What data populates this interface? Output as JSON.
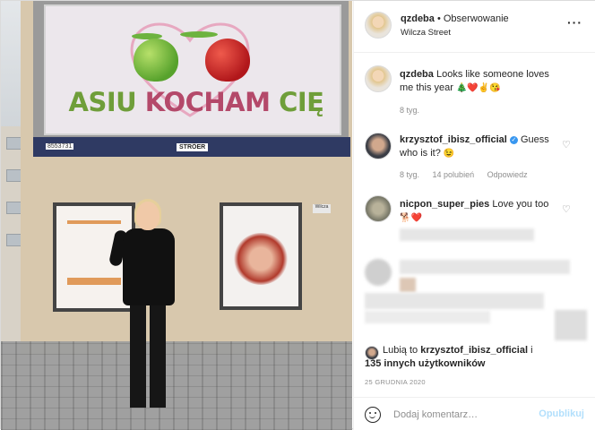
{
  "header": {
    "username": "qzdeba",
    "follow_sep": " • ",
    "follow_label": "Obserwowanie",
    "location": "Wilcza Street",
    "more_icon": "more-horizontal-icon"
  },
  "photo": {
    "billboard_text_a": "ASIU ",
    "billboard_text_b": "KOCHAM",
    "billboard_text_c": " CIĘ",
    "band_number": "8553731",
    "band_logo": "STRÖER",
    "plate_text": "Wilcza"
  },
  "caption": {
    "username": "qzdeba",
    "text": "Looks like someone loves me this year",
    "emojis": "🎄❤️✌️😘",
    "time": "8 tyg."
  },
  "comments": [
    {
      "username": "krzysztof_ibisz_official",
      "verified": true,
      "text": "Guess who is it?",
      "emojis": "😉",
      "time": "8 tyg.",
      "likes": "14 polubień",
      "reply": "Odpowiedz"
    },
    {
      "username": "nicpon_super_pies",
      "verified": false,
      "text": "Love you too",
      "emojis": "🐕❤️"
    }
  ],
  "likes_summary": {
    "prefix": "Lubią to ",
    "user": "krzysztof_ibisz_official",
    "mid": " i",
    "count": "135 innych użytkowników"
  },
  "date": "25 GRUDNIA 2020",
  "add_comment": {
    "placeholder": "Dodaj komentarz…",
    "post_label": "Opublikuj"
  },
  "colors": {
    "link": "#0095f6",
    "post_disabled": "#b2dffc",
    "verified": "#3897f0",
    "like_heart": "#ed4956"
  }
}
